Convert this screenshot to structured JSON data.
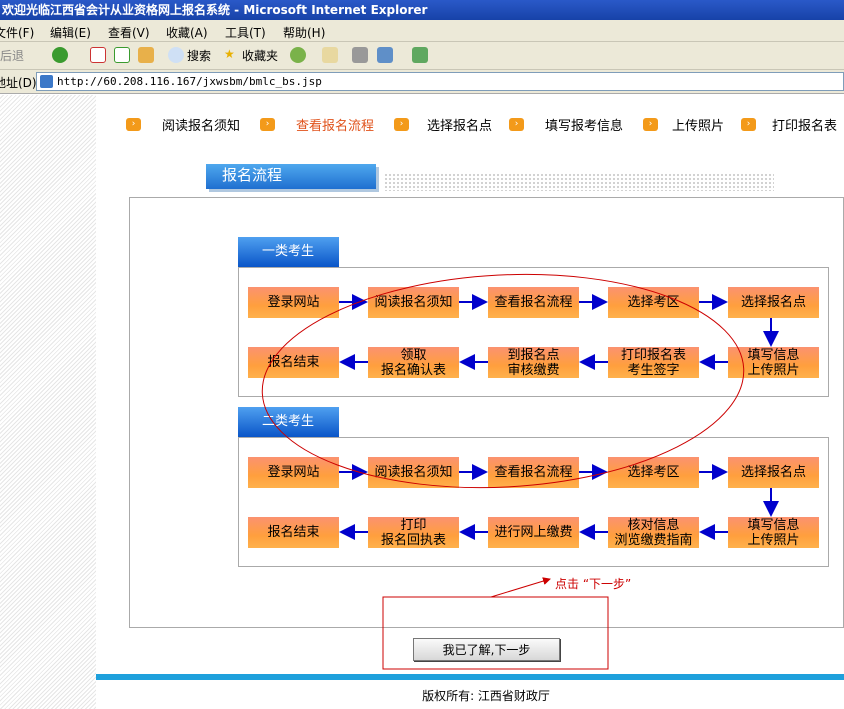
{
  "window": {
    "title": "欢迎光临江西省会计从业资格网上报名系统 - Microsoft Internet Explorer"
  },
  "menubar": [
    "文件(F)",
    "编辑(E)",
    "查看(V)",
    "收藏(A)",
    "工具(T)",
    "帮助(H)"
  ],
  "toolbar": {
    "back": "后退",
    "search": "搜索",
    "favorites": "收藏夹"
  },
  "address": {
    "label": "地址(D)",
    "url": "http://60.208.116.167/jxwsbm/bmlc_bs.jsp"
  },
  "steps": [
    "阅读报名须知",
    "查看报名流程",
    "选择报名点",
    "填写报考信息",
    "上传照片",
    "打印报名表"
  ],
  "active_step": 1,
  "colors": {
    "step_active": "#e0521b",
    "step_icon": "#f39a1a",
    "flow_box": "#ff9f3d",
    "arrow": "#0000cc",
    "annotation": "#cc0000",
    "section_tab": "#1f6fd0"
  },
  "section_title": "报名流程",
  "group1": {
    "title": "一类考生",
    "row1": [
      "登录网站",
      "阅读报名须知",
      "查看报名流程",
      "选择考区",
      "选择报名点"
    ],
    "row2": [
      "报名结束",
      "领取\n报名确认表",
      "到报名点\n审核缴费",
      "打印报名表\n考生签字",
      "填写信息\n上传照片"
    ]
  },
  "group2": {
    "title": "二类考生",
    "row1": [
      "登录网站",
      "阅读报名须知",
      "查看报名流程",
      "选择考区",
      "选择报名点"
    ],
    "row2": [
      "报名结束",
      "打印\n报名回执表",
      "进行网上缴费",
      "核对信息\n浏览缴费指南",
      "填写信息\n上传照片"
    ]
  },
  "annotation": "点击 “下一步”",
  "next_button": "我已了解,下一步",
  "footer": "版权所有: 江西省财政厅"
}
